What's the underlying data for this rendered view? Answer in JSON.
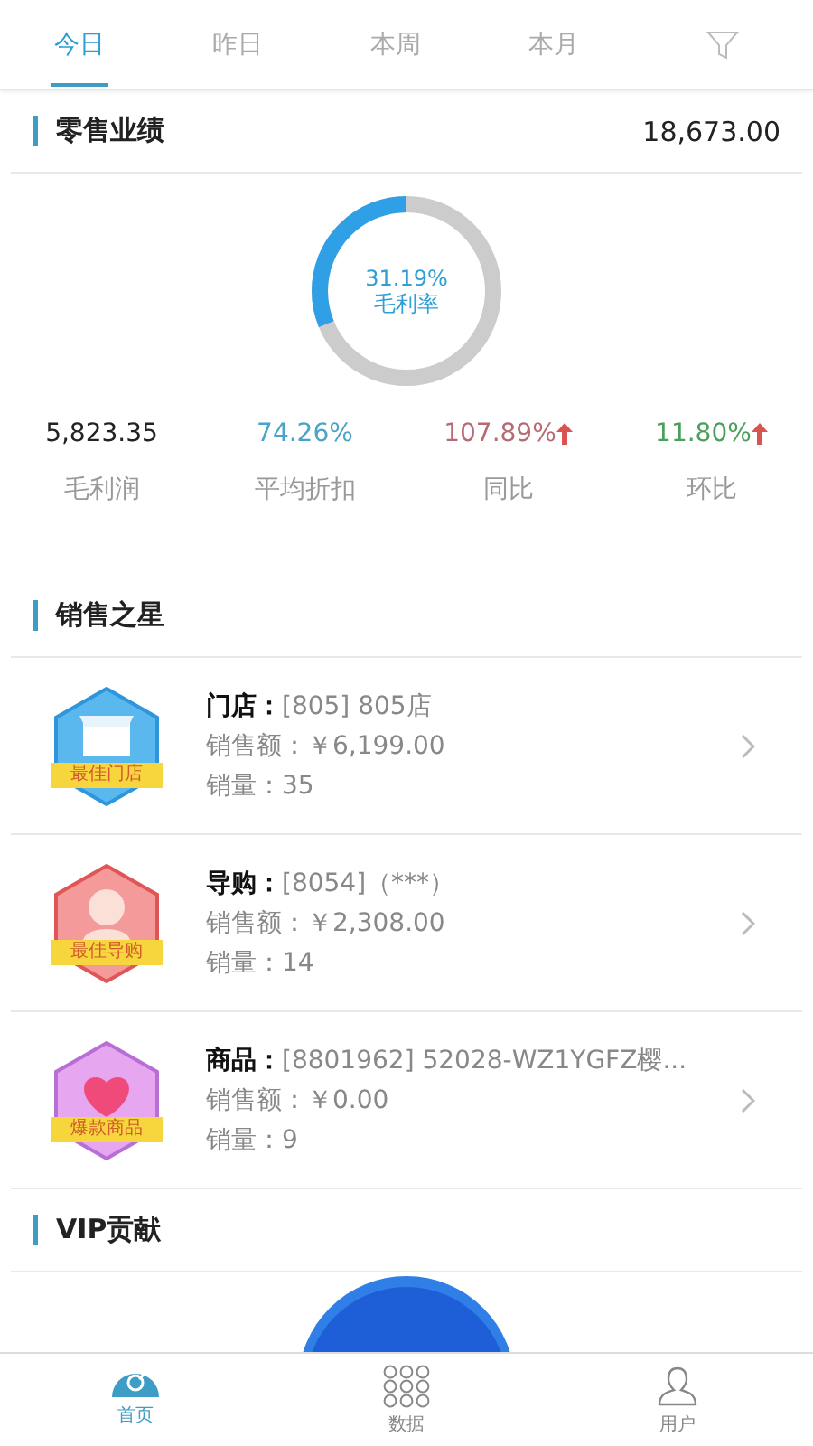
{
  "tabs": [
    {
      "label": "今日",
      "selected": true
    },
    {
      "label": "昨日",
      "selected": false
    },
    {
      "label": "本周",
      "selected": false
    },
    {
      "label": "本月",
      "selected": false
    }
  ],
  "retail": {
    "title": "零售业绩",
    "total": "18,673.00",
    "gauge": {
      "level": 0.3119,
      "value": "31.19%",
      "label": "毛利率"
    }
  },
  "metrics": [
    {
      "value": "5,823.35",
      "label": "毛利润",
      "color": "#222222",
      "rising": false
    },
    {
      "value": "74.26%",
      "label": "平均折扣",
      "color": "#4aa3c8",
      "rising": false
    },
    {
      "value": "107.89%",
      "label": "同比",
      "color": "#b86a74",
      "rising": true
    },
    {
      "value": "11.80%",
      "label": "环比",
      "color": "#4aa05a",
      "rising": true
    }
  ],
  "stars": {
    "title": "销售之星",
    "items": [
      {
        "kind": "store",
        "badge": "最佳门店",
        "name_label": "门店：",
        "name": "[805] 805店",
        "amount_label": "销售额：",
        "amount": "￥6,199.00",
        "qty_label": "销量：",
        "qty": "35"
      },
      {
        "kind": "guide",
        "badge": "最佳导购",
        "name_label": "导购：",
        "name": "[8054]（***）",
        "amount_label": "销售额：",
        "amount": "￥2,308.00",
        "qty_label": "销量：",
        "qty": "14"
      },
      {
        "kind": "product",
        "badge": "爆款商品",
        "name_label": "商品：",
        "name": "[8801962] 52028-WZ1YGFZ樱...",
        "amount_label": "销售额：",
        "amount": "￥0.00",
        "qty_label": "销量：",
        "qty": "9"
      }
    ]
  },
  "vip": {
    "title": "VIP贡献"
  },
  "nav": [
    {
      "kind": "home",
      "label": "首页",
      "selected": true
    },
    {
      "kind": "data",
      "label": "数据",
      "selected": false
    },
    {
      "kind": "user",
      "label": "用户",
      "selected": false
    }
  ]
}
